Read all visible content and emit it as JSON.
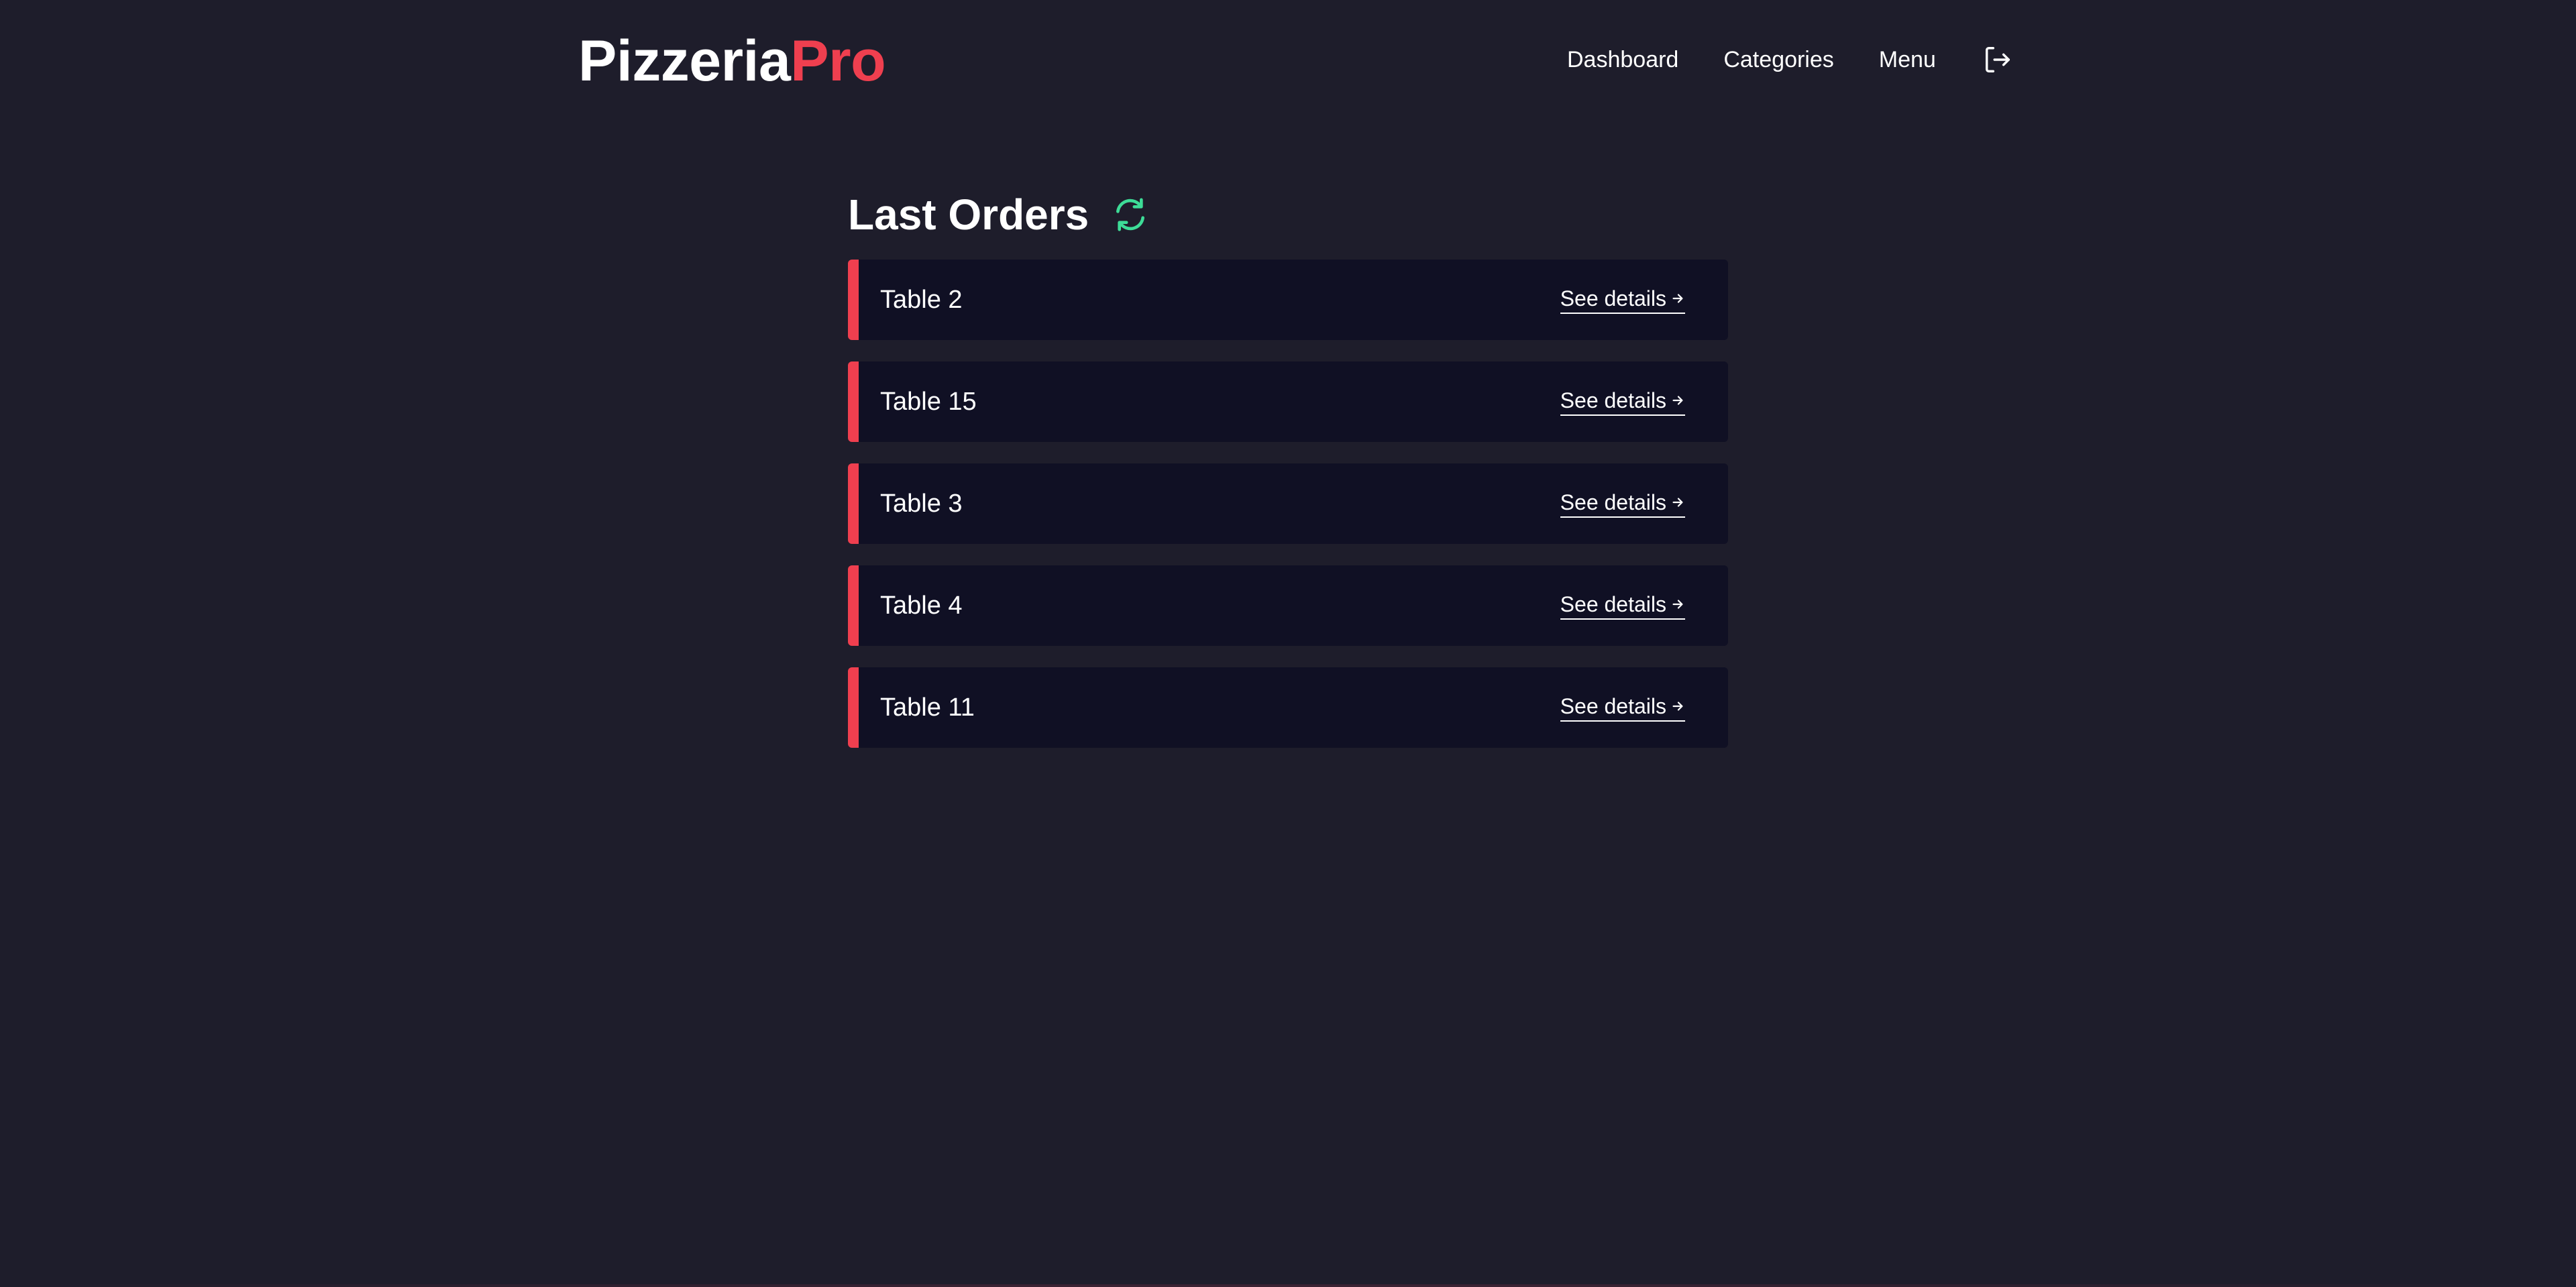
{
  "brand": {
    "name_main": "Pizzeria",
    "name_accent": "Pro",
    "accent_color": "#ef3f4f"
  },
  "nav": {
    "items": [
      {
        "label": "Dashboard"
      },
      {
        "label": "Categories"
      },
      {
        "label": "Menu"
      }
    ],
    "logout_icon": "logout-icon"
  },
  "main": {
    "title": "Last Orders",
    "refresh_icon": "refresh-icon",
    "refresh_color": "#3ddc97",
    "details_label": "See details",
    "orders": [
      {
        "table": "Table 2"
      },
      {
        "table": "Table 15"
      },
      {
        "table": "Table 3"
      },
      {
        "table": "Table 4"
      },
      {
        "table": "Table 11"
      }
    ]
  }
}
